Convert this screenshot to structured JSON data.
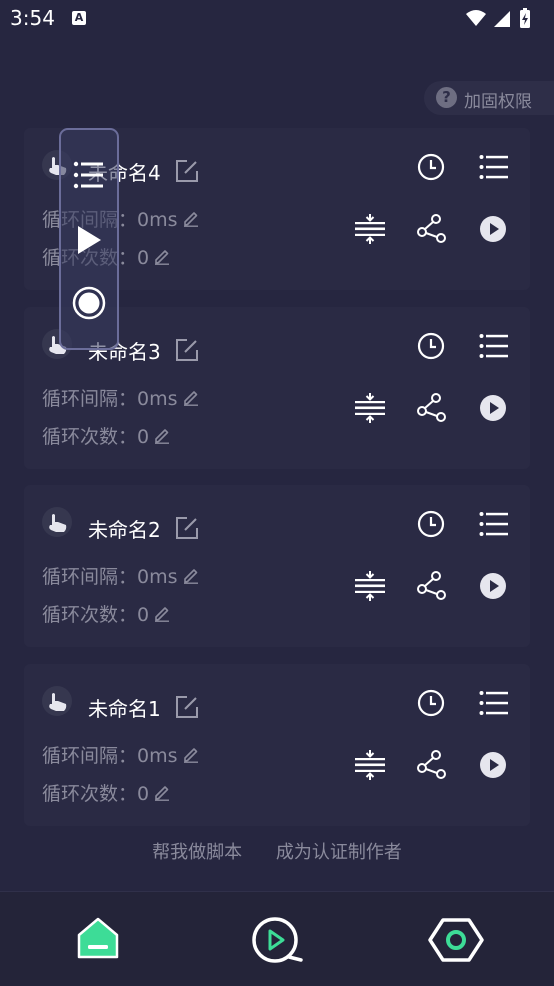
{
  "status_bar": {
    "time": "3:54",
    "notification_icon": "a-icon",
    "system_icons": [
      "wifi-icon",
      "signal-icon",
      "battery-charging-icon"
    ]
  },
  "permission_button": {
    "icon": "question-icon",
    "icon_glyph": "?",
    "label": "加固权限"
  },
  "cards": [
    {
      "title": "未命名4",
      "interval_label": "循环间隔：",
      "interval_value": "0ms",
      "count_label": "循环次数：",
      "count_value": "0"
    },
    {
      "title": "未命名3",
      "interval_label": "循环间隔：",
      "interval_value": "0ms",
      "count_label": "循环次数：",
      "count_value": "0"
    },
    {
      "title": "未命名2",
      "interval_label": "循环间隔：",
      "interval_value": "0ms",
      "count_label": "循环次数：",
      "count_value": "0"
    },
    {
      "title": "未命名1",
      "interval_label": "循环间隔：",
      "interval_value": "0ms",
      "count_label": "循环次数：",
      "count_value": "0"
    }
  ],
  "card_actions": [
    "clock-icon",
    "list-icon",
    "split-icon",
    "share-icon",
    "play-icon"
  ],
  "floating_panel": [
    "list-icon",
    "play-icon",
    "record-icon"
  ],
  "footer": {
    "help_link": "帮我做脚本",
    "author_link": "成为认证制作者"
  },
  "bottom_nav": [
    "home-icon",
    "video-play-icon",
    "settings-hex-icon"
  ],
  "colors": {
    "background": "#262640",
    "card": "#2a2a44",
    "muted_text": "#8a8a9c",
    "accent_green": "#3ddc97"
  }
}
